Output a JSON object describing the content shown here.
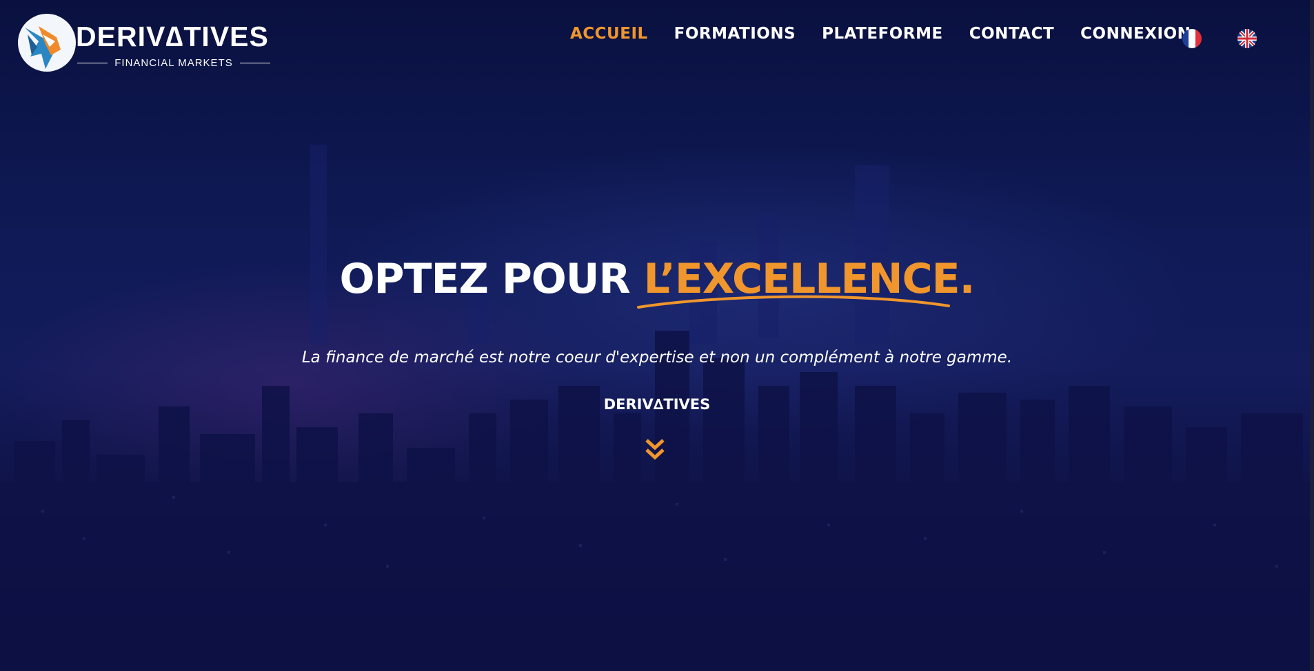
{
  "logo": {
    "title": "DERIV∆TIVES",
    "subtitle": "FINANCIAL MARKETS"
  },
  "nav": {
    "items": [
      {
        "label": "ACCUEIL",
        "active": true
      },
      {
        "label": "FORMATIONS",
        "active": false
      },
      {
        "label": "PLATEFORME",
        "active": false
      },
      {
        "label": "CONTACT",
        "active": false
      },
      {
        "label": "CONNEXION",
        "active": false
      }
    ],
    "languages": [
      "flag-fr-icon",
      "flag-uk-icon"
    ]
  },
  "hero": {
    "headline_prefix": "OPTEZ POUR",
    "headline_accent": "L’EXCELLENCE.",
    "tagline": "La finance de marché est notre coeur d'expertise et non un complément à notre gamme.",
    "brand": "DERIV∆TIVES",
    "scroll_icon": "double-chevron-down-icon"
  },
  "colors": {
    "accent": "#f0962c",
    "background": "#0b0f3a",
    "text": "#ffffff"
  }
}
